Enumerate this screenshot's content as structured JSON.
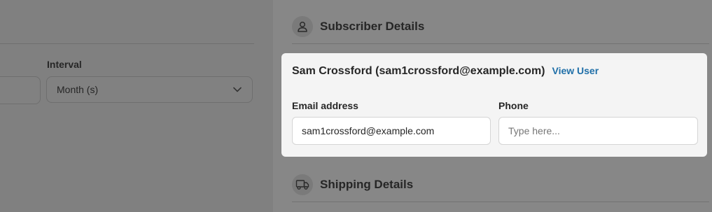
{
  "left": {
    "interval": {
      "label": "Interval",
      "value": "Month (s)",
      "icon": "chevron-down-icon"
    }
  },
  "right": {
    "subscriber": {
      "title": "Subscriber Details",
      "icon": "user-icon",
      "name_line": "Sam Crossford (sam1crossford@example.com)",
      "view_user_label": "View User",
      "email_label": "Email address",
      "email_value": "sam1crossford@example.com",
      "phone_label": "Phone",
      "phone_placeholder": "Type here..."
    },
    "shipping": {
      "title": "Shipping Details",
      "icon": "truck-icon"
    }
  },
  "colors": {
    "link": "#1f6fa8",
    "overlay": "#858585",
    "card": "#f4f4f4"
  }
}
